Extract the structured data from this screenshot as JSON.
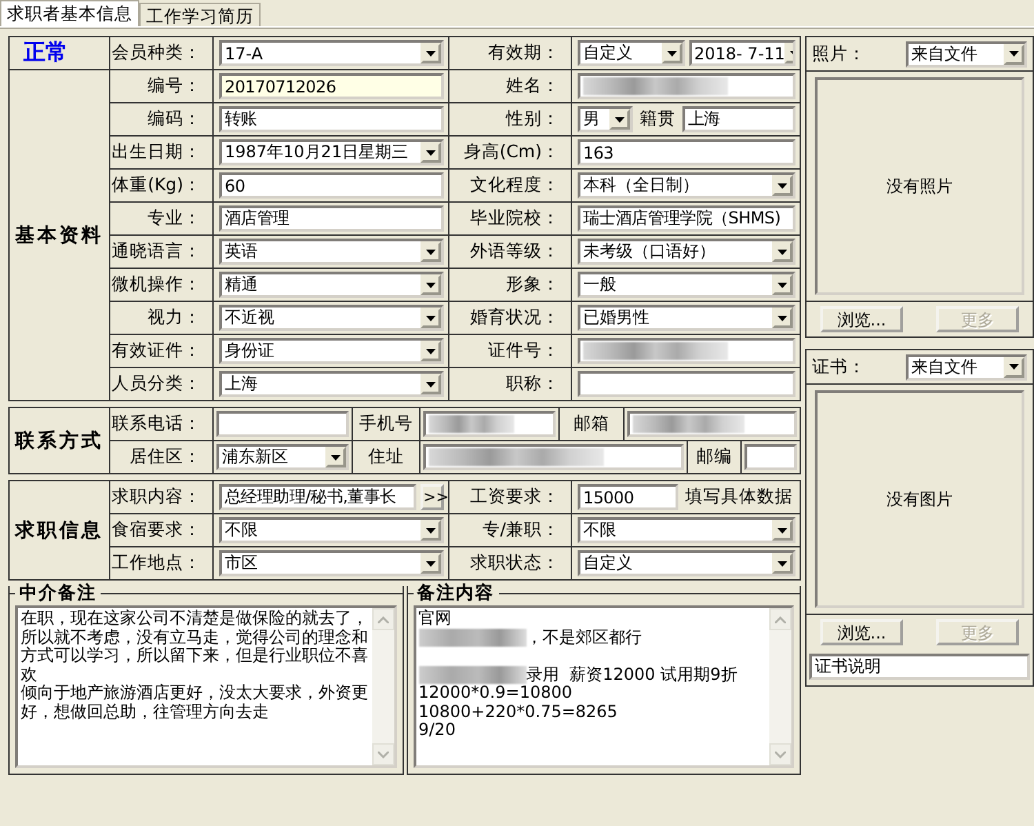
{
  "tabs": [
    {
      "label": "求职者基本信息",
      "selected": true
    },
    {
      "label": "工作学习简历",
      "selected": false
    }
  ],
  "status": "正常",
  "basic_title": "基本资料",
  "main_rows": [
    {
      "left_label": "会员种类：",
      "left": [
        {
          "kind": "dropdown",
          "value": "17-A"
        }
      ],
      "right_label": "有效期：",
      "right": [
        {
          "kind": "dropdown",
          "value": "自定义"
        },
        {
          "kind": "dropdown",
          "value": "2018- 7-11"
        }
      ]
    },
    {
      "left_label": "编号：",
      "left": [
        {
          "kind": "readonly",
          "value": "20170712026"
        }
      ],
      "right_label": "姓名：",
      "right": [
        {
          "kind": "redacted"
        }
      ]
    },
    {
      "left_label": "编码：",
      "left": [
        {
          "kind": "text",
          "value": "转账"
        }
      ],
      "right_label": "性别：",
      "right": [
        {
          "kind": "small_dropdown",
          "value": "男"
        },
        {
          "kind": "label",
          "value": "籍贯"
        },
        {
          "kind": "text",
          "value": "上海"
        }
      ]
    },
    {
      "left_label": "出生日期：",
      "left": [
        {
          "kind": "dropdown",
          "value": "1987年10月21日星期三"
        }
      ],
      "right_label": "身高(Cm)：",
      "right": [
        {
          "kind": "text",
          "value": "163"
        }
      ]
    },
    {
      "left_label": "体重(Kg)：",
      "left": [
        {
          "kind": "text",
          "value": "60"
        }
      ],
      "right_label": "文化程度：",
      "right": [
        {
          "kind": "dropdown",
          "value": "本科（全日制）"
        }
      ]
    },
    {
      "left_label": "专业：",
      "left": [
        {
          "kind": "text",
          "value": "酒店管理"
        }
      ],
      "right_label": "毕业院校：",
      "right": [
        {
          "kind": "text",
          "value": "瑞士酒店管理学院（SHMS)"
        }
      ]
    },
    {
      "left_label": "通晓语言：",
      "left": [
        {
          "kind": "dropdown",
          "value": "英语"
        }
      ],
      "right_label": "外语等级：",
      "right": [
        {
          "kind": "dropdown",
          "value": "未考级（口语好）"
        }
      ]
    },
    {
      "left_label": "微机操作：",
      "left": [
        {
          "kind": "dropdown",
          "value": "精通"
        }
      ],
      "right_label": "形象：",
      "right": [
        {
          "kind": "dropdown",
          "value": "一般"
        }
      ]
    },
    {
      "left_label": "视力：",
      "left": [
        {
          "kind": "dropdown",
          "value": "不近视"
        }
      ],
      "right_label": "婚育状况：",
      "right": [
        {
          "kind": "dropdown",
          "value": "已婚男性"
        }
      ]
    },
    {
      "left_label": "有效证件：",
      "left": [
        {
          "kind": "dropdown",
          "value": "身份证"
        }
      ],
      "right_label": "证件号：",
      "right": [
        {
          "kind": "redacted"
        }
      ]
    },
    {
      "left_label": "人员分类：",
      "left": [
        {
          "kind": "dropdown",
          "value": "上海"
        }
      ],
      "right_label": "职称：",
      "right": [
        {
          "kind": "text"
        }
      ]
    }
  ],
  "contact": {
    "title": "联系方式",
    "rows": [
      [
        {
          "kind": "label",
          "value": "联系电话："
        },
        {
          "kind": "text"
        },
        {
          "kind": "label",
          "value": "手机号"
        },
        {
          "kind": "redacted"
        },
        {
          "kind": "label",
          "value": "邮箱"
        },
        {
          "kind": "redacted"
        }
      ],
      [
        {
          "kind": "label",
          "value": "居住区："
        },
        {
          "kind": "dropdown",
          "value": "浦东新区"
        },
        {
          "kind": "label",
          "value": "住址"
        },
        {
          "kind": "redacted"
        },
        {
          "kind": "label",
          "value": "邮编"
        },
        {
          "kind": "text"
        }
      ]
    ]
  },
  "job": {
    "title": "求职信息",
    "rows": [
      {
        "left_label": "求职内容：",
        "left": [
          {
            "kind": "text",
            "value": "总经理助理/秘书,董事长"
          },
          {
            "kind": "button",
            "value": ">>"
          }
        ],
        "right_label": "工资要求：",
        "right": [
          {
            "kind": "text",
            "value": "15000"
          },
          {
            "kind": "note",
            "value": "填写具体数据"
          }
        ]
      },
      {
        "left_label": "食宿要求：",
        "left": [
          {
            "kind": "dropdown",
            "value": "不限"
          }
        ],
        "right_label": "专/兼职：",
        "right": [
          {
            "kind": "dropdown",
            "value": "不限"
          }
        ]
      },
      {
        "left_label": "工作地点：",
        "left": [
          {
            "kind": "dropdown",
            "value": "市区"
          }
        ],
        "right_label": "求职状态：",
        "right": [
          {
            "kind": "dropdown",
            "value": "自定义"
          }
        ]
      }
    ]
  },
  "notes": [
    {
      "title": "中介备注",
      "lines": [
        {
          "text": "在职，现在这家公司不清楚是做保险的就去了，"
        },
        {
          "text": "所以就不考虑，没有立马走，觉得公司的理念和"
        },
        {
          "text": "方式可以学习，所以留下来，但是行业职位不喜"
        },
        {
          "text": "欢"
        },
        {
          "text": "倾向于地产旅游酒店更好，没太大要求，外资更"
        },
        {
          "text": "好，想做回总助，往管理方向去走"
        }
      ]
    },
    {
      "title": "备注内容",
      "lines": [
        {
          "text": "官网"
        },
        {
          "text": "，不是郊区都行",
          "blurred": true
        },
        {
          "kind": "gap"
        },
        {
          "text": "录用  薪资12000 试用期9折",
          "blurred": true
        },
        {
          "text": "12000*0.9=10800"
        },
        {
          "text": "10800+220*0.75=8265"
        },
        {
          "text": "9/20"
        }
      ]
    }
  ],
  "photo": {
    "label": "照片：",
    "source": "来自文件",
    "empty_text": "没有照片",
    "buttons": [
      {
        "label": "浏览...",
        "disabled": false
      },
      {
        "label": "更多",
        "disabled": true
      }
    ]
  },
  "certificate": {
    "label": "证书：",
    "source": "来自文件",
    "empty_text": "没有图片",
    "buttons": [
      {
        "label": "浏览...",
        "disabled": false
      },
      {
        "label": "更多",
        "disabled": true
      }
    ],
    "caption": "证书说明"
  }
}
